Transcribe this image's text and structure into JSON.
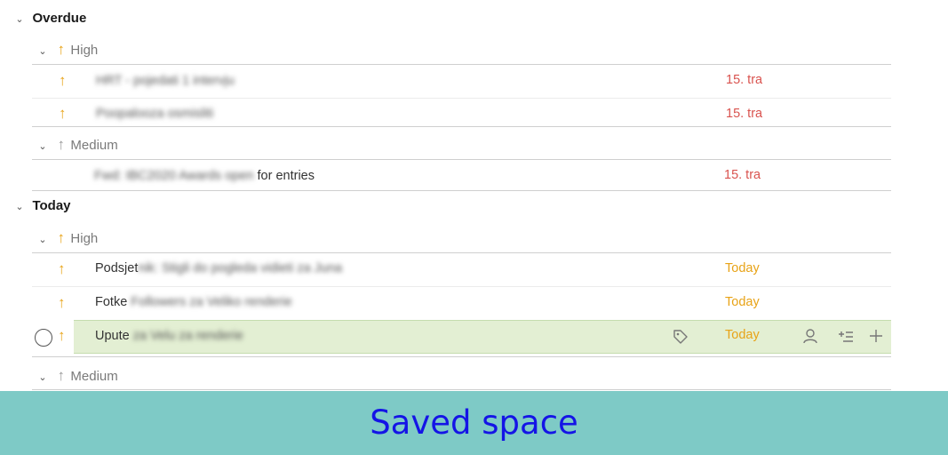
{
  "sections": [
    {
      "title": "Overdue",
      "groups": [
        {
          "label": "High",
          "tasks": [
            {
              "prefix": "HRT",
              "text": " - pojedati 1 intervju",
              "date": "15. tra"
            },
            {
              "prefix": "",
              "text": "Poopalooza osmisliti",
              "date": "15. tra"
            }
          ]
        },
        {
          "label": "Medium",
          "tasks": [
            {
              "prefix": "Fwd:",
              "text": " IBC2020 Awards open",
              "suffix": " for entries",
              "date": "15. tra"
            }
          ]
        }
      ]
    },
    {
      "title": "Today",
      "groups": [
        {
          "label": "High",
          "tasks": [
            {
              "prefix": "Podsjet",
              "text": "nik: Stigli do pogleda vidieti za Juna",
              "date": "Today"
            },
            {
              "prefix": "Fotke",
              "text": " Followers za Veliko renderie",
              "date": "Today"
            },
            {
              "prefix": "Upute",
              "text": " za Velu za renderie",
              "date": "Today"
            }
          ]
        },
        {
          "label": "Medium",
          "tasks": []
        }
      ]
    }
  ],
  "footer": {
    "label": "Saved space"
  },
  "icons": {
    "collapse": "chevron-down-icon",
    "priority_high": "arrow-up-icon",
    "priority_medium": "arrow-up-icon",
    "complete": "circle-checkbox-icon",
    "label": "tag-icon",
    "assign": "person-icon",
    "subtask": "add-subtask-icon",
    "add": "plus-icon"
  },
  "colors": {
    "overdue_date": "#d9534f",
    "today_date": "#e8a317",
    "high_priority": "#e8a317",
    "highlight_row": "#e3efd3",
    "footer_bg": "#7ecac6",
    "footer_text": "#1414e6"
  }
}
